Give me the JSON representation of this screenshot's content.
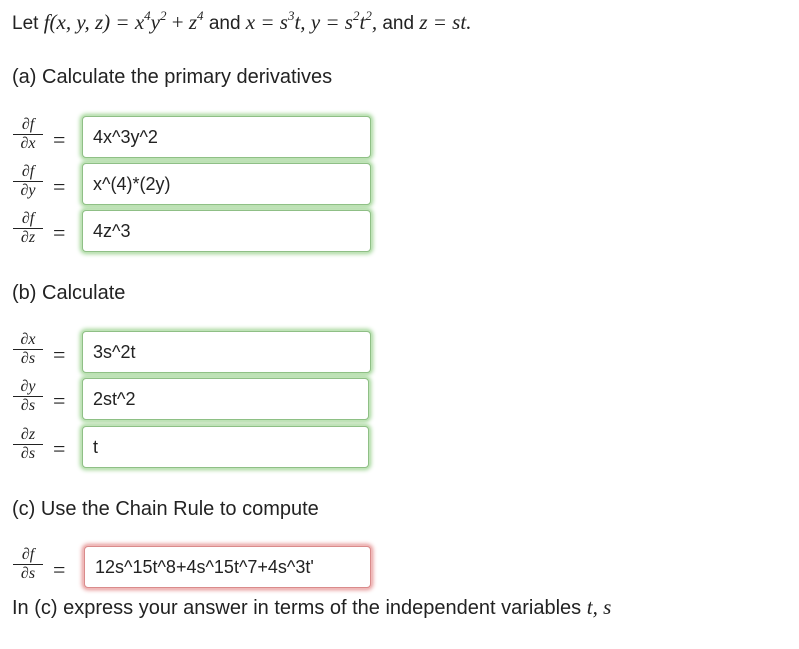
{
  "problem": {
    "lead": "Let",
    "func_lhs": "f(x, y, z) = x",
    "and1": "and",
    "x_def": "x = s",
    "y_def": "y = s",
    "and2": "and",
    "z_def": "z = st."
  },
  "part_a": {
    "heading": "(a) Calculate the primary derivatives",
    "rows": [
      {
        "num": "∂f",
        "den": "∂x",
        "value": "4x^3y^2"
      },
      {
        "num": "∂f",
        "den": "∂y",
        "value": "x^(4)*(2y)"
      },
      {
        "num": "∂f",
        "den": "∂z",
        "value": "4z^3"
      }
    ]
  },
  "part_b": {
    "heading": "(b) Calculate",
    "rows": [
      {
        "num": "∂x",
        "den": "∂s",
        "value": "3s^2t"
      },
      {
        "num": "∂y",
        "den": "∂s",
        "value": "2st^2"
      },
      {
        "num": "∂z",
        "den": "∂s",
        "value": "t"
      }
    ]
  },
  "part_c": {
    "heading": "(c) Use the Chain Rule to compute",
    "row": {
      "num": "∂f",
      "den": "∂s",
      "value": "12s^15t^8+4s^15t^7+4s^3t'"
    },
    "note": "In (c) express your answer in terms of the independent variables",
    "vars": "t, s"
  },
  "equals": "=",
  "status_colors": {
    "correct": "#9ed493",
    "incorrect": "#e49090"
  }
}
